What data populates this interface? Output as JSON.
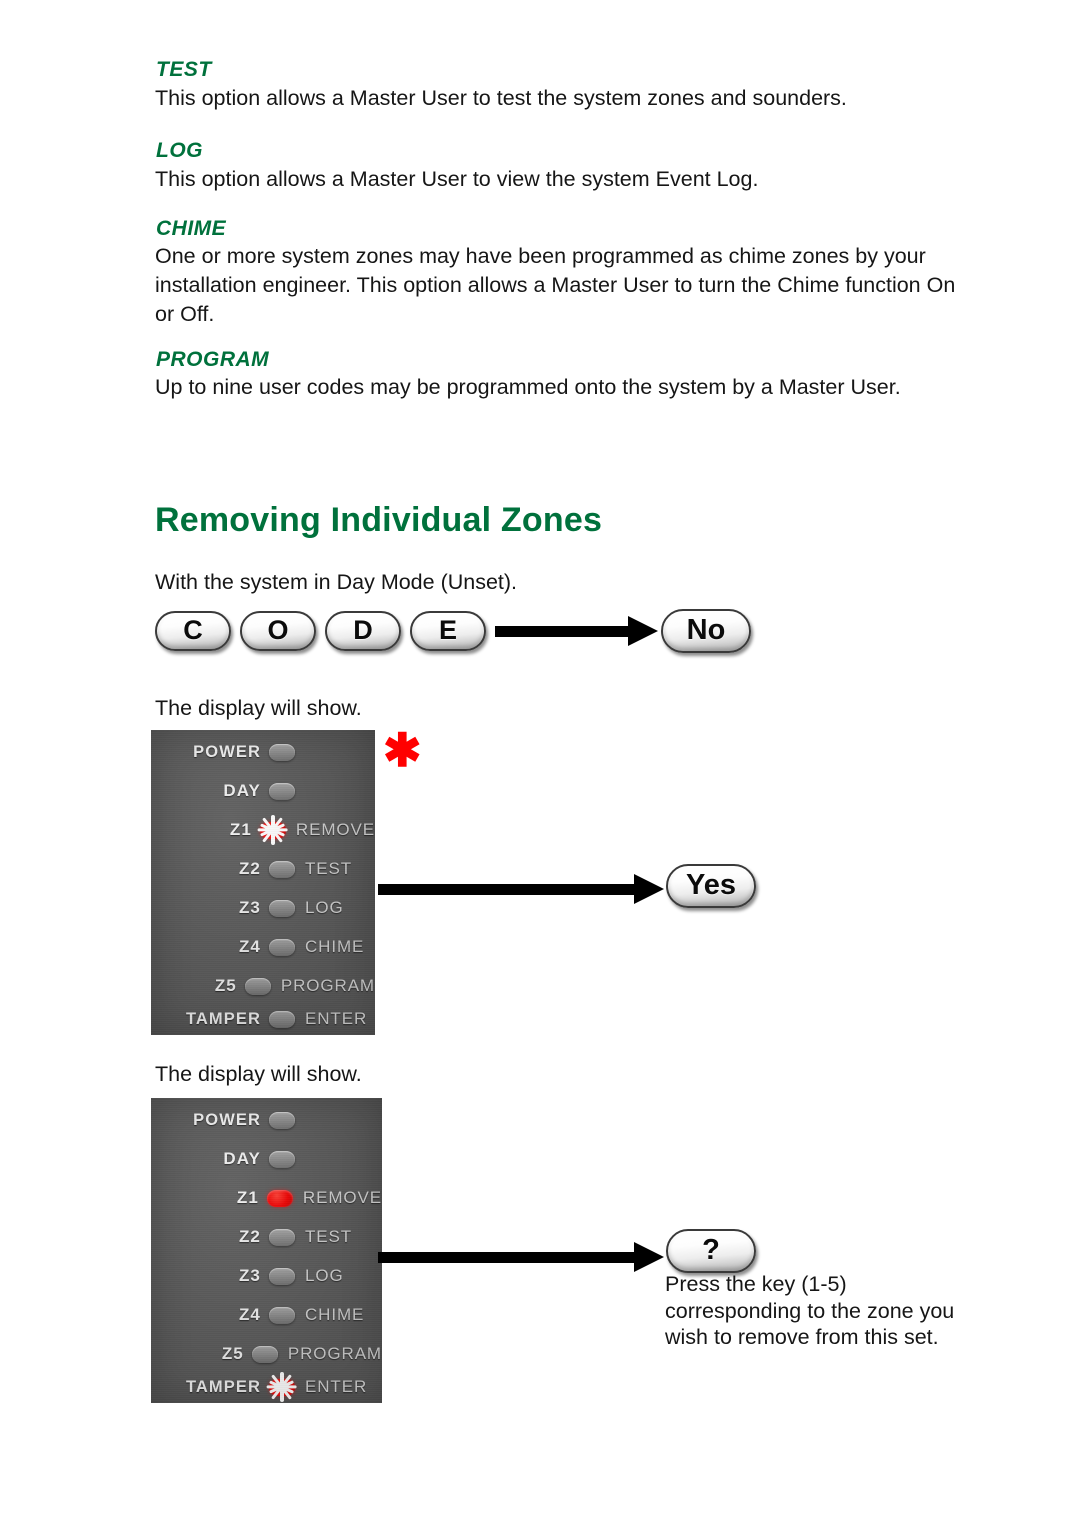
{
  "sections": [
    {
      "heading": "TEST",
      "body": "This option allows a Master User to test the system zones and sounders."
    },
    {
      "heading": "LOG",
      "body": "This option allows a Master User to view the system Event Log."
    },
    {
      "heading": "CHIME",
      "body": "One or more system zones may have been programmed as chime zones by your installation engineer. This option allows a Master User to turn the Chime function On or Off."
    },
    {
      "heading": "PROGRAM",
      "body": "Up to nine user codes may be programmed onto the system by a Master User."
    }
  ],
  "title": "Removing Individual Zones",
  "intro": "With the system in Day Mode (Unset).",
  "code_sequence": {
    "keys": [
      "C",
      "O",
      "D",
      "E"
    ],
    "result_key": "No"
  },
  "step_one": {
    "caption": "The display will show.",
    "asterisk": "✱",
    "result_key": "Yes"
  },
  "step_two": {
    "caption": "The display will show.",
    "result_key": "?",
    "note": "Press the key (1-5) corresponding to the zone you wish to remove from this set."
  },
  "panel_one": {
    "rows": [
      {
        "left": "POWER",
        "right": "",
        "lamp": "off"
      },
      {
        "left": "DAY",
        "right": "",
        "lamp": "off"
      },
      {
        "left": "Z1",
        "right": "REMOVE",
        "lamp": "flash"
      },
      {
        "left": "Z2",
        "right": "TEST",
        "lamp": "off"
      },
      {
        "left": "Z3",
        "right": "LOG",
        "lamp": "off"
      },
      {
        "left": "Z4",
        "right": "CHIME",
        "lamp": "off"
      },
      {
        "left": "Z5",
        "right": "PROGRAM",
        "lamp": "off"
      },
      {
        "left": "TAMPER",
        "right": "ENTER",
        "lamp": "off"
      }
    ]
  },
  "panel_two": {
    "rows": [
      {
        "left": "POWER",
        "right": "",
        "lamp": "off"
      },
      {
        "left": "DAY",
        "right": "",
        "lamp": "off"
      },
      {
        "left": "Z1",
        "right": "REMOVE",
        "lamp": "on"
      },
      {
        "left": "Z2",
        "right": "TEST",
        "lamp": "off"
      },
      {
        "left": "Z3",
        "right": "LOG",
        "lamp": "off"
      },
      {
        "left": "Z4",
        "right": "CHIME",
        "lamp": "off"
      },
      {
        "left": "Z5",
        "right": "PROGRAM",
        "lamp": "off"
      },
      {
        "left": "TAMPER",
        "right": "ENTER",
        "lamp": "flash"
      }
    ]
  },
  "colors": {
    "heading_green": "#00713c",
    "led_red": "#f00000",
    "panel_gray": "#5b5b5b"
  }
}
